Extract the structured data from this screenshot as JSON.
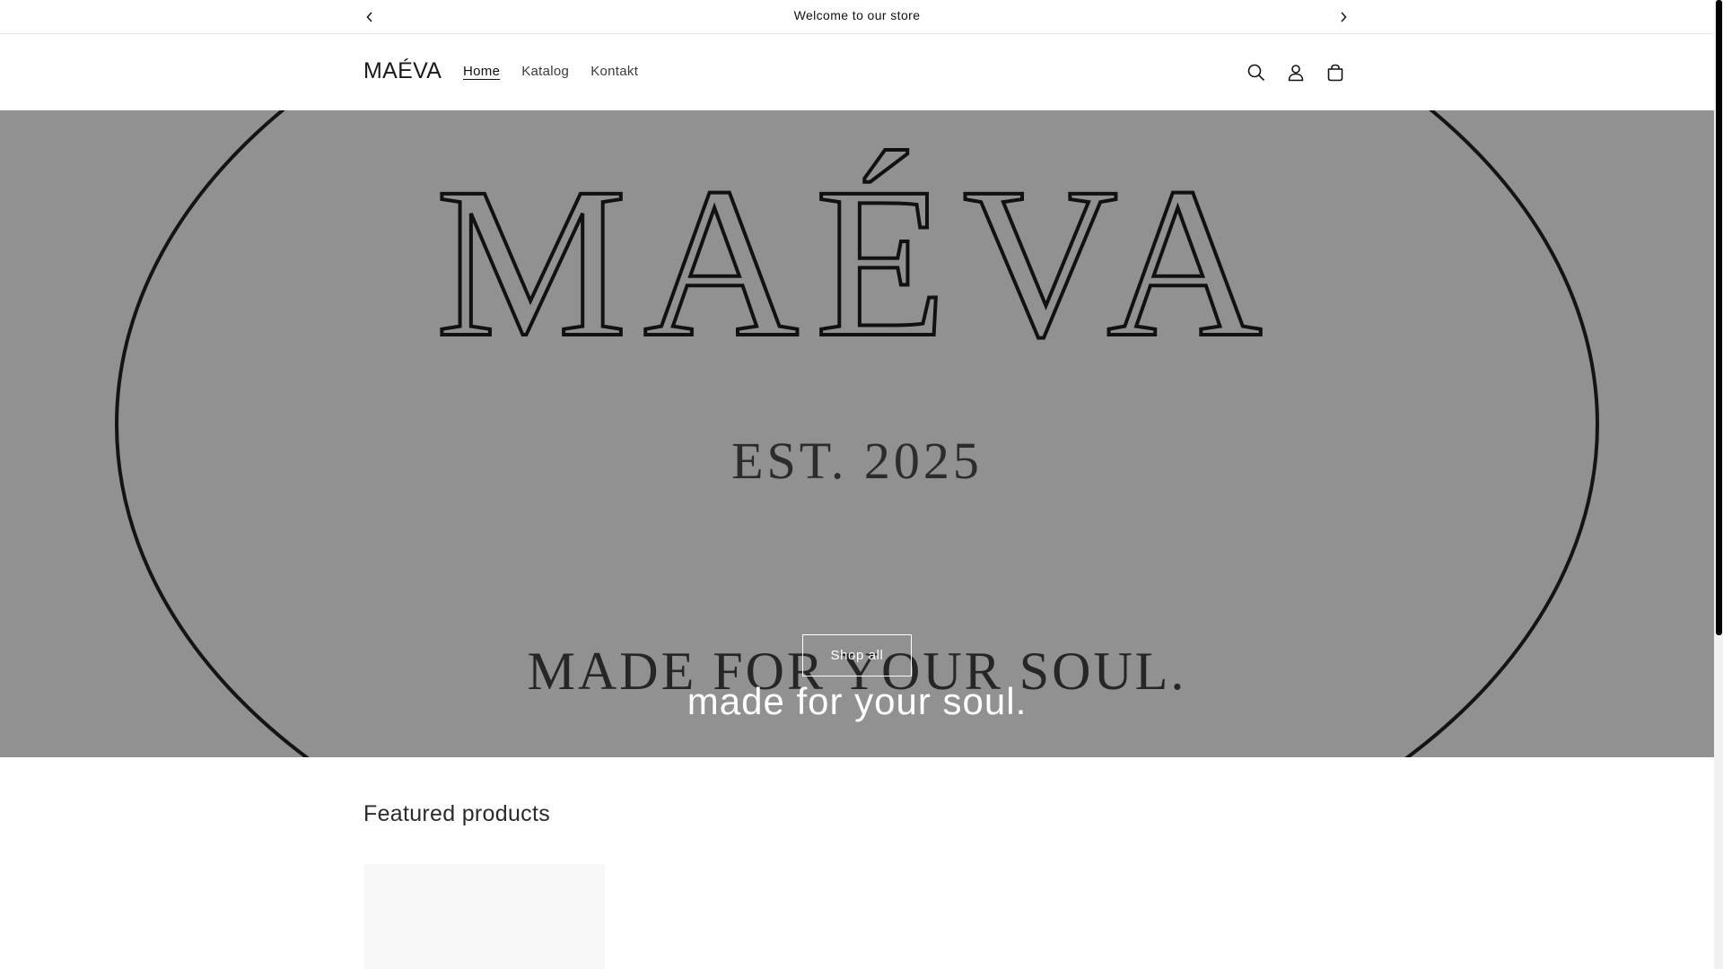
{
  "announcement": {
    "message": "Welcome to our store"
  },
  "header": {
    "logo": "MAÉVA",
    "nav": [
      {
        "label": "Home"
      },
      {
        "label": "Katalog"
      },
      {
        "label": "Kontakt"
      }
    ],
    "icons": [
      "search-icon",
      "account-icon",
      "cart-icon"
    ]
  },
  "hero": {
    "image_text": {
      "brand": "MAÉVA",
      "est": "EST. 2025",
      "tagline": "MADE FOR YOUR SOUL."
    },
    "heading": "made for your soul.",
    "button_label": "Shop all",
    "overlay_color": "#919191"
  },
  "featured": {
    "title": "Featured products"
  },
  "colors": {
    "accent": "#121212",
    "hero_bg": "#919191"
  }
}
